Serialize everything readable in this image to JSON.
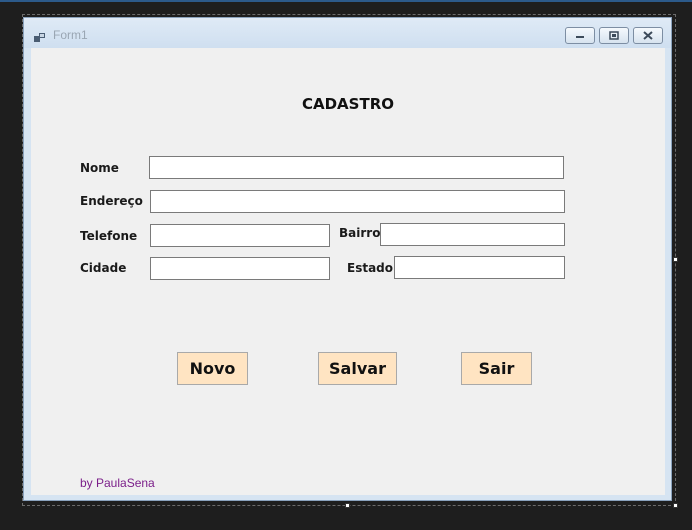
{
  "window": {
    "title": "Form1",
    "app_icon": "form-app-icon",
    "controls": [
      "minimize-icon",
      "maximize-icon",
      "close-icon"
    ]
  },
  "form": {
    "heading": "CADASTRO",
    "fields": {
      "nome": {
        "label": "Nome",
        "value": ""
      },
      "endereco": {
        "label": "Endereço",
        "value": ""
      },
      "telefone": {
        "label": "Telefone",
        "value": ""
      },
      "bairro": {
        "label": "Bairro",
        "value": ""
      },
      "cidade": {
        "label": "Cidade",
        "value": ""
      },
      "estado": {
        "label": "Estado",
        "value": ""
      }
    },
    "buttons": {
      "novo": "Novo",
      "salvar": "Salvar",
      "sair": "Sair"
    },
    "credit": "by PaulaSena"
  },
  "colors": {
    "button_bg": "#ffe4c2",
    "credit_text": "#7b1f8a",
    "client_bg": "#f0f0f0",
    "frame": "#d6e4f2"
  }
}
